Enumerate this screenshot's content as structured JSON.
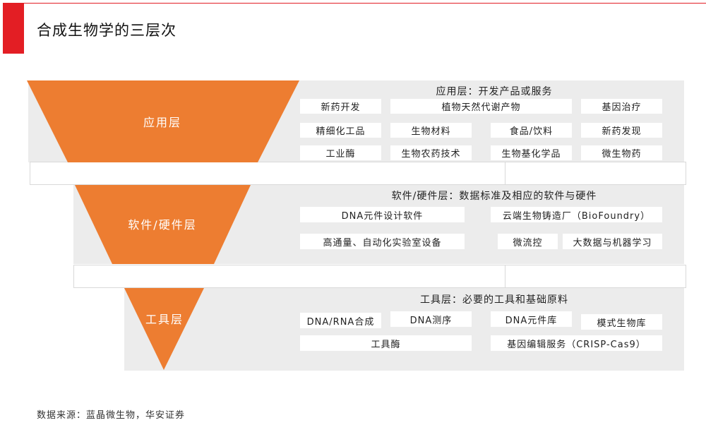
{
  "header": {
    "title": "合成生物学的三层次"
  },
  "colors": {
    "accent_red": "#e31e24",
    "funnel_orange": "#ed7d31",
    "band_gray": "#ececec"
  },
  "layers": [
    {
      "label": "应用层",
      "title": "应用层：开发产品或服务",
      "items": [
        "新药开发",
        "植物天然代谢产物",
        "基因治疗",
        "精细化工品",
        "生物材料",
        "食品/饮料",
        "新药发现",
        "工业酶",
        "生物农药技术",
        "生物基化学品",
        "微生物药"
      ]
    },
    {
      "label": "软件/硬件层",
      "title": "软件/硬件层：数据标准及相应的软件与硬件",
      "items": [
        "DNA元件设计软件",
        "云端生物铸造厂（BioFoundry）",
        "高通量、自动化实验室设备",
        "微流控",
        "大数据与机器学习"
      ]
    },
    {
      "label": "工具层",
      "title": "工具层：必要的工具和基础原料",
      "items": [
        "DNA/RNA合成",
        "DNA测序",
        "DNA元件库",
        "模式生物库",
        "工具酶",
        "基因编辑服务（CRISP-Cas9）"
      ]
    }
  ],
  "footer": {
    "source": "数据来源：蓝晶微生物，华安证券"
  }
}
